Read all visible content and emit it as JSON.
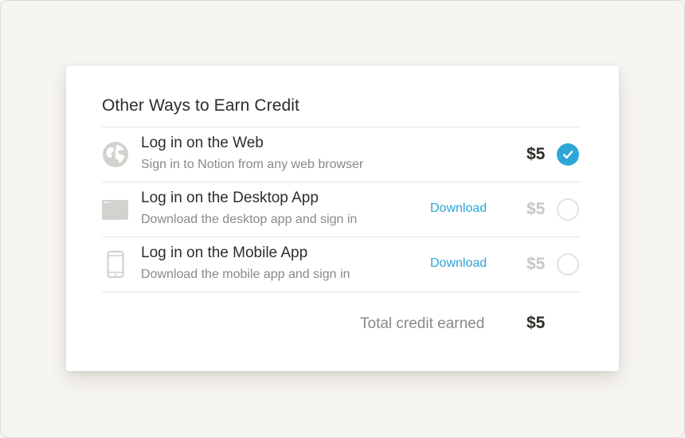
{
  "section": {
    "title": "Other Ways to Earn Credit"
  },
  "rows": [
    {
      "icon": "globe-icon",
      "title": "Log in on the Web",
      "subtitle": "Sign in to Notion from any web browser",
      "download_label": "",
      "amount": "$5",
      "completed": true
    },
    {
      "icon": "desktop-window-icon",
      "title": "Log in on the Desktop App",
      "subtitle": "Download the desktop app and sign in",
      "download_label": "Download",
      "amount": "$5",
      "completed": false
    },
    {
      "icon": "mobile-phone-icon",
      "title": "Log in on the Mobile App",
      "subtitle": "Download the mobile app and sign in",
      "download_label": "Download",
      "amount": "$5",
      "completed": false
    }
  ],
  "total": {
    "label": "Total credit earned",
    "amount": "$5"
  },
  "colors": {
    "accent": "#2ea6d8",
    "text": "#2f2d29",
    "muted_text": "#8b8985",
    "muted_amount": "#c9c7c3",
    "icon_gray": "#d3d2cf",
    "background": "#f7f5f1"
  }
}
